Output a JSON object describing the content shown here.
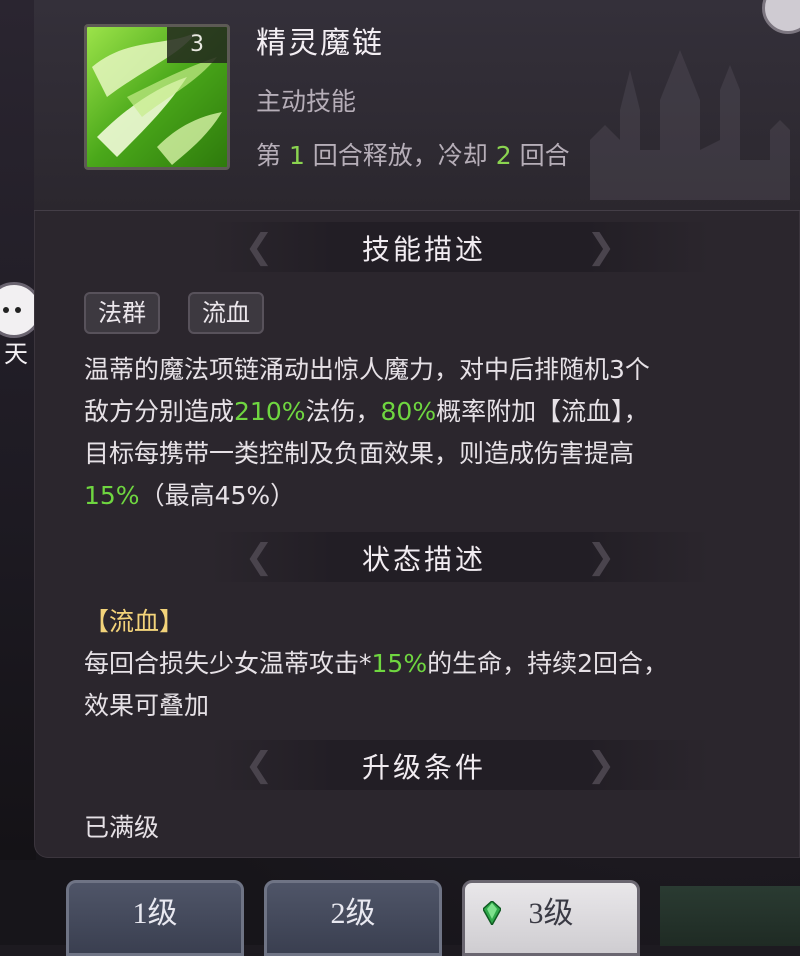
{
  "skill": {
    "name": "精灵魔链",
    "type": "主动技能",
    "level": "3",
    "cooldown": {
      "prefix": "第 ",
      "release_round": "1",
      "mid": " 回合释放，冷却 ",
      "cooldown_rounds": "2",
      "suffix": " 回合"
    }
  },
  "sections": {
    "description_title": "技能描述",
    "status_title": "状态描述",
    "upgrade_title": "升级条件"
  },
  "tags": [
    "法群",
    "流血"
  ],
  "description": {
    "line1": "温蒂的魔法项链涌动出惊人魔力，对中后排随机3个",
    "line2_a": "敌方分别造成",
    "line2_b": "210%",
    "line2_c": "法伤，",
    "line2_d": "80%",
    "line2_e": "概率附加【流血】，",
    "line3": "目标每携带一类控制及负面效果，则造成伤害提高",
    "line4_a": "15%",
    "line4_b": "（最高45%）"
  },
  "status": {
    "name": "【流血】",
    "line1_a": "每回合损失少女温蒂攻击*",
    "line1_b": "15%",
    "line1_c": "的生命，持续2回合，",
    "line2": "效果可叠加"
  },
  "upgrade": {
    "text": "已满级"
  },
  "side": {
    "char": "天"
  },
  "level_tabs": [
    {
      "label": "1级",
      "selected": false
    },
    {
      "label": "2级",
      "selected": false
    },
    {
      "label": "3级",
      "selected": true
    }
  ],
  "colors": {
    "highlight_green": "#6fd640",
    "status_gold": "#f3d37a",
    "panel_bg": "#2b262d"
  }
}
